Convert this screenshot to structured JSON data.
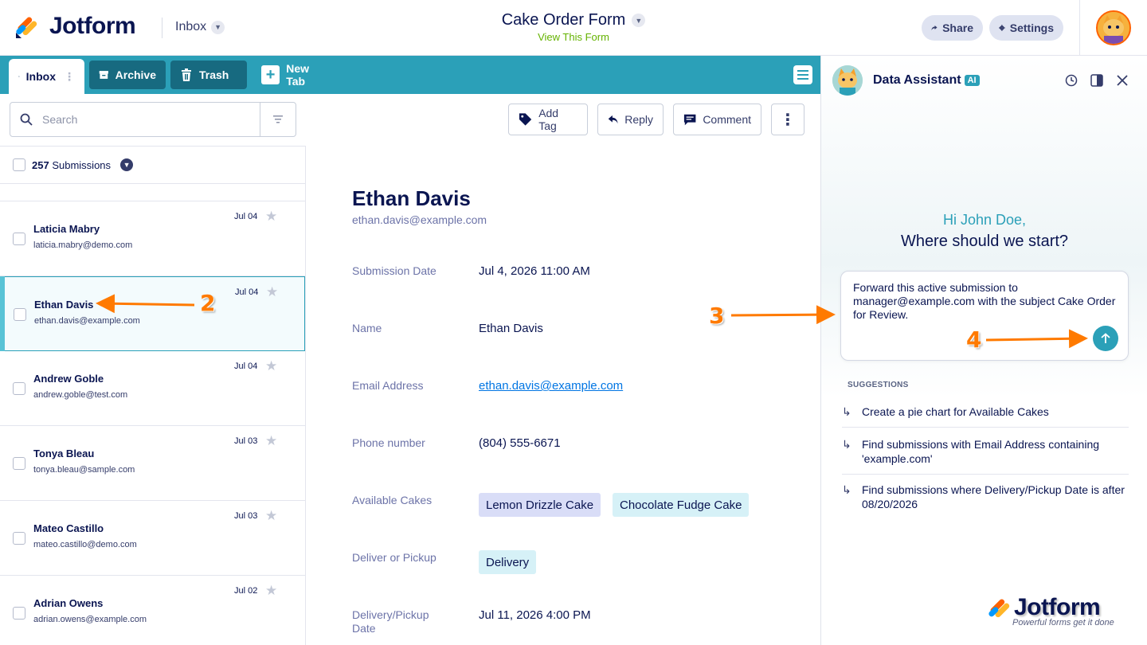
{
  "header": {
    "brand": "Jotform",
    "inbox_label": "Inbox",
    "form_title": "Cake Order Form",
    "view_form": "View This Form",
    "share": "Share",
    "settings": "Settings"
  },
  "tabs": {
    "inbox": "Inbox",
    "archive": "Archive",
    "trash": "Trash",
    "new_tab": "New Tab"
  },
  "toolbar": {
    "search_placeholder": "Search",
    "add_tag": "Add Tag",
    "reply": "Reply",
    "comment": "Comment"
  },
  "list": {
    "count": "257",
    "count_label": "Submissions",
    "rows": [
      {
        "name": "Laticia Mabry",
        "email": "laticia.mabry@demo.com",
        "date": "Jul 04"
      },
      {
        "name": "Ethan Davis",
        "email": "ethan.davis@example.com",
        "date": "Jul 04"
      },
      {
        "name": "Andrew Goble",
        "email": "andrew.goble@test.com",
        "date": "Jul 04"
      },
      {
        "name": "Tonya Bleau",
        "email": "tonya.bleau@sample.com",
        "date": "Jul 03"
      },
      {
        "name": "Mateo Castillo",
        "email": "mateo.castillo@demo.com",
        "date": "Jul 03"
      },
      {
        "name": "Adrian Owens",
        "email": "adrian.owens@example.com",
        "date": "Jul 02"
      }
    ]
  },
  "detail": {
    "name": "Ethan Davis",
    "email": "ethan.davis@example.com",
    "fields": [
      {
        "label": "Submission Date",
        "value": "Jul 4, 2026 11:00 AM"
      },
      {
        "label": "Name",
        "value": "Ethan Davis"
      },
      {
        "label": "Email Address",
        "value": "ethan.davis@example.com"
      },
      {
        "label": "Phone number",
        "value": "(804) 555-6671"
      },
      {
        "label": "Available Cakes",
        "chips": [
          "Lemon Drizzle Cake",
          "Chocolate Fudge Cake"
        ]
      },
      {
        "label": "Deliver or Pickup",
        "chips": [
          "Delivery"
        ]
      },
      {
        "label": "Delivery/Pickup Date",
        "value": "Jul 11, 2026 4:00 PM"
      }
    ]
  },
  "assistant": {
    "title": "Data Assistant",
    "ai_badge": "AI",
    "greeting": "Hi John Doe,",
    "question": "Where should we start?",
    "prompt": "Forward this active submission to manager@example.com with the subject Cake Order for Review.",
    "suggestions_heading": "SUGGESTIONS",
    "suggestions": [
      "Create a pie chart for Available Cakes",
      "Find submissions with Email Address containing 'example.com'",
      "Find submissions where Delivery/Pickup Date is after 08/20/2026"
    ],
    "watermark": "Jotform",
    "watermark_tagline": "Powerful forms get it done"
  },
  "annotations": [
    "2",
    "3",
    "4"
  ],
  "colors": {
    "accent": "#2ba0b8",
    "navy": "#0a1551",
    "annotation": "#ff7a00",
    "chip_purple": "#d9ddf7",
    "chip_cyan": "#d6f1f7"
  }
}
